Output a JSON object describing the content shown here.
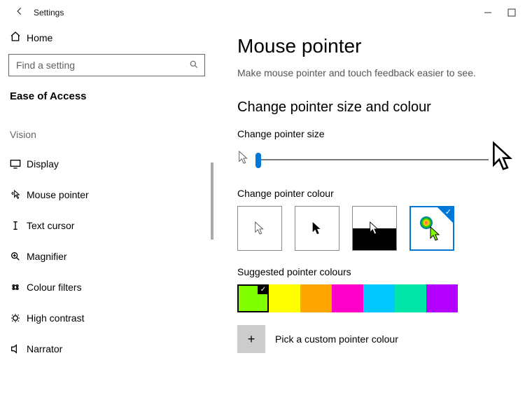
{
  "app": {
    "title": "Settings"
  },
  "sidebar": {
    "home": "Home",
    "search_placeholder": "Find a setting",
    "category": "Ease of Access",
    "group": "Vision",
    "items": [
      {
        "label": "Display"
      },
      {
        "label": "Mouse pointer"
      },
      {
        "label": "Text cursor"
      },
      {
        "label": "Magnifier"
      },
      {
        "label": "Colour filters"
      },
      {
        "label": "High contrast"
      },
      {
        "label": "Narrator"
      }
    ]
  },
  "main": {
    "heading": "Mouse pointer",
    "subtitle": "Make mouse pointer and touch feedback easier to see.",
    "section_title": "Change pointer size and colour",
    "size_label": "Change pointer size",
    "colour_label": "Change pointer colour",
    "suggested_label": "Suggested pointer colours",
    "swatches": [
      "#7FFF00",
      "#FFFF00",
      "#FFA500",
      "#FF00C8",
      "#00C8FF",
      "#00E6A8",
      "#B400FF"
    ],
    "selected_swatch": 0,
    "custom_label": "Pick a custom pointer colour"
  }
}
